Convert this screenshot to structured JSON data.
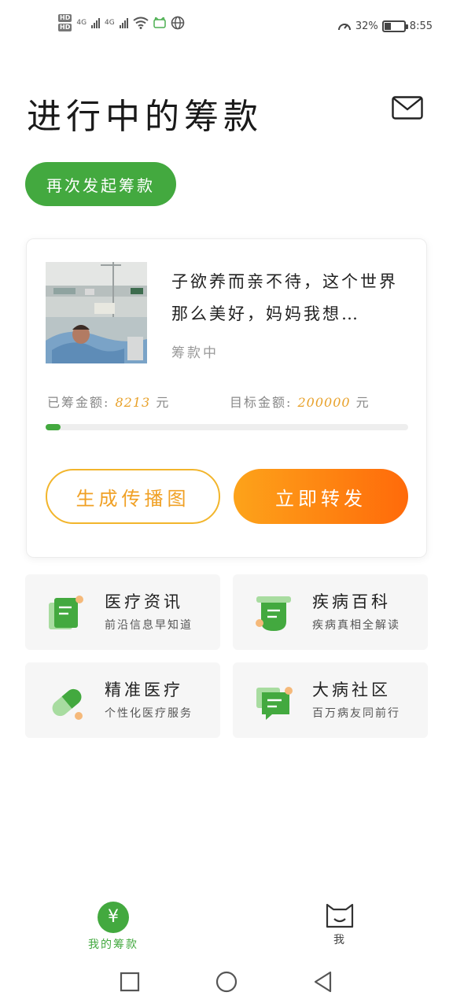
{
  "status_bar": {
    "hd1": "HD",
    "hd2": "HD",
    "net1": "4G",
    "net2": "4G",
    "battery_percent": "32%",
    "battery_level": 0.32,
    "time": "8:55"
  },
  "header": {
    "title": "进行中的筹款",
    "mail_icon": "mail-icon"
  },
  "relaunch_button": "再次发起筹款",
  "campaign": {
    "description": "子欲养而亲不待，这个世界那么美好，妈妈我想…",
    "status": "筹款中",
    "raised_label": "已筹金额:",
    "raised_amount": "8213",
    "raised_unit": "元",
    "target_label": "目标金额:",
    "target_amount": "200000",
    "target_unit": "元",
    "progress": 0.041,
    "generate_button": "生成传播图",
    "share_button": "立即转发"
  },
  "features": [
    {
      "title": "医疗资讯",
      "subtitle": "前沿信息早知道",
      "icon": "document-icon"
    },
    {
      "title": "疾病百科",
      "subtitle": "疾病真相全解读",
      "icon": "scroll-icon"
    },
    {
      "title": "精准医疗",
      "subtitle": "个性化医疗服务",
      "icon": "pill-icon"
    },
    {
      "title": "大病社区",
      "subtitle": "百万病友同前行",
      "icon": "chat-icon"
    }
  ],
  "tabs": {
    "my_fundraising": "我的筹款",
    "me": "我",
    "yen": "¥"
  },
  "colors": {
    "accent_green": "#43a93f",
    "orange": "#ff7a0f",
    "gold": "#f2b52c"
  }
}
